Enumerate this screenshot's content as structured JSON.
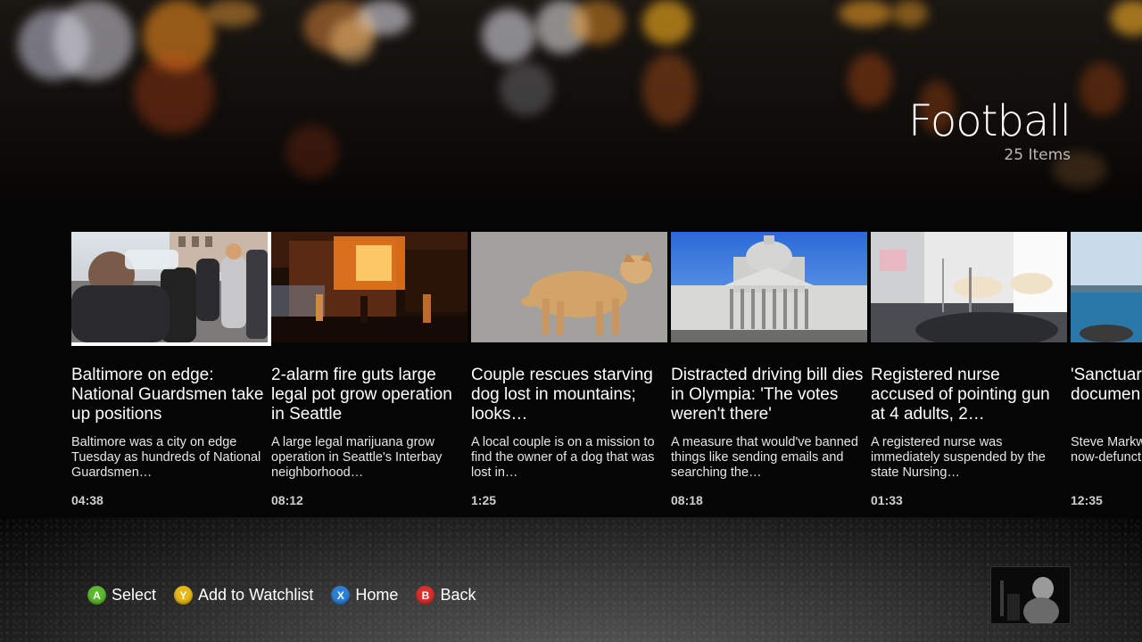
{
  "header": {
    "title": "Football",
    "item_count": "25 Items"
  },
  "videos": [
    {
      "title": "Baltimore on edge: National Guardsmen take up positions",
      "description": "Baltimore was a city on edge Tuesday as hundreds of National Guardsmen…",
      "duration": "04:38",
      "thumb_icon": "crowd-photo"
    },
    {
      "title": "2-alarm fire guts large legal pot grow operation in Seattle",
      "description": "A large legal marijuana grow operation in Seattle's Interbay neighborhood…",
      "duration": "08:12",
      "thumb_icon": "fire-photo"
    },
    {
      "title": "Couple rescues starving dog lost in mountains; looks…",
      "description": "A local couple is on a mission to find the owner of a dog that was lost in…",
      "duration": "1:25",
      "thumb_icon": "dog-photo"
    },
    {
      "title": "Distracted driving bill dies in Olympia: 'The votes weren't there'",
      "description": "A measure that would've banned things like sending emails and searching the…",
      "duration": "08:18",
      "thumb_icon": "capitol-photo"
    },
    {
      "title": "Registered nurse accused of pointing gun at 4 adults, 2…",
      "description": "A registered nurse was immediately suspended by the state Nursing…",
      "duration": "01:33",
      "thumb_icon": "lab-photo"
    },
    {
      "title": "'Sanctuary' founder g… documen…",
      "description": "Steve Markw… controversia… now-defunct…",
      "duration": "12:35",
      "thumb_icon": "water-photo"
    }
  ],
  "controls": [
    {
      "glyph": "A",
      "label": "Select",
      "color": "#5cb82e"
    },
    {
      "glyph": "Y",
      "label": "Add to Watchlist",
      "color": "#e6b817"
    },
    {
      "glyph": "X",
      "label": "Home",
      "color": "#2d7fd6"
    },
    {
      "glyph": "B",
      "label": "Back",
      "color": "#d8302c"
    }
  ],
  "colors": {
    "focus_outline": "#ffffff",
    "secondary_text": "#b8b8b8"
  }
}
